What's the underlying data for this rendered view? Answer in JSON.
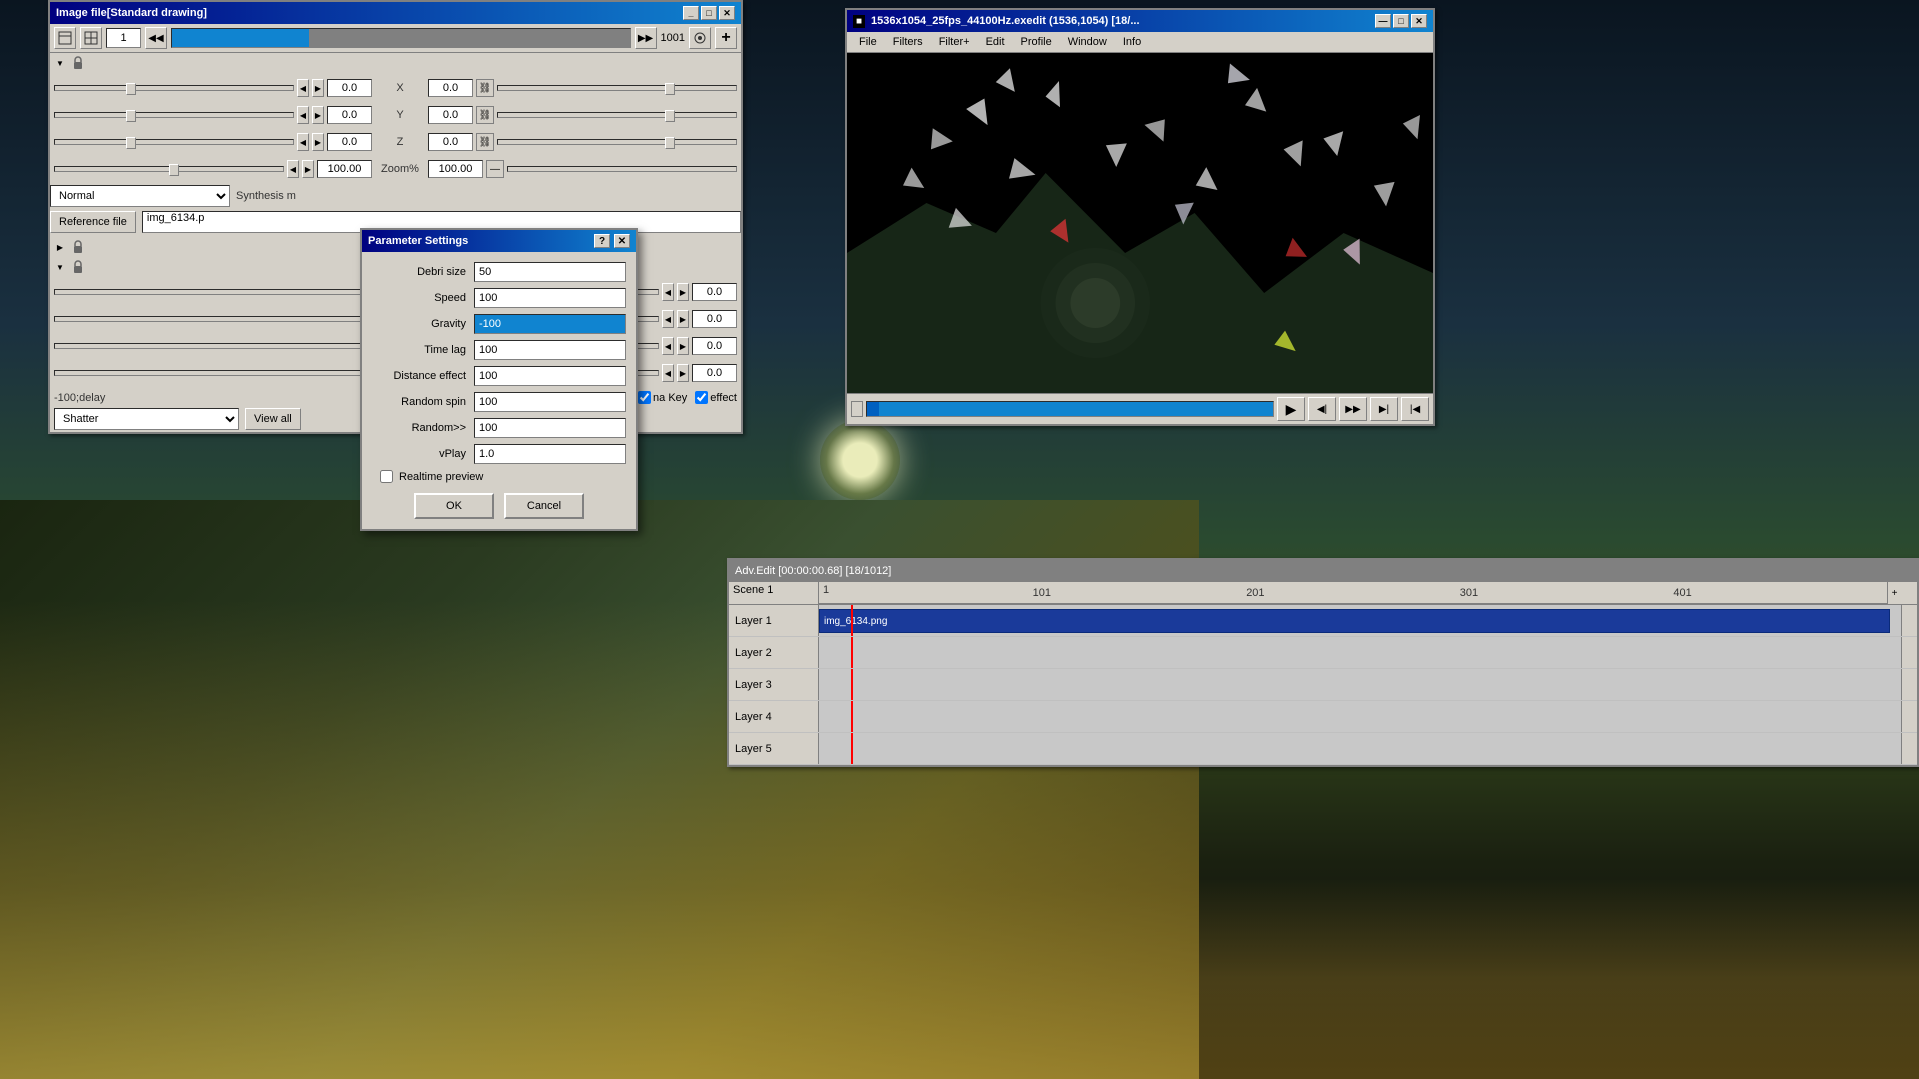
{
  "background": {
    "description": "dark night scene with water and cliffs"
  },
  "imageFilePanel": {
    "title": "Image file[Standard drawing]",
    "frameStart": "1",
    "frameEnd": "1001",
    "labelRight": "Image file[Standard drawing]",
    "checkboxChecked": true,
    "params": [
      {
        "label": "X",
        "value": "0.0",
        "valueRight": "0.0"
      },
      {
        "label": "Y",
        "value": "0.0",
        "valueRight": "0.0"
      },
      {
        "label": "Z",
        "value": "0.0",
        "valueRight": "0.0"
      },
      {
        "label": "Zoom%",
        "value": "100.00",
        "valueRight": "100.00"
      }
    ],
    "params2": [
      {
        "value": "0.0"
      },
      {
        "value": "0.0"
      },
      {
        "value": "0.0"
      },
      {
        "value": "0.0"
      }
    ],
    "normalLabel": "Normal",
    "synthesisLabel": "Synthesis m",
    "referenceFileLabel": "Reference file",
    "referenceFileValue": "img_6134.p",
    "chromaKeyLabel": "na Key",
    "chromaKeyChecked": true,
    "distanceEffectLabel": "effect",
    "distanceEffectChecked": true,
    "shatterLabel": "Shatter",
    "viewAllLabel": "View all",
    "effectText": "-100;delay"
  },
  "paramDialog": {
    "title": "Parameter Settings",
    "fields": [
      {
        "label": "Debri size",
        "value": "50",
        "selected": false
      },
      {
        "label": "Speed",
        "value": "100",
        "selected": false
      },
      {
        "label": "Gravity",
        "value": "-100",
        "selected": true
      },
      {
        "label": "Time lag",
        "value": "100",
        "selected": false
      },
      {
        "label": "Distance effect",
        "value": "100",
        "selected": false
      },
      {
        "label": "Random spin",
        "value": "100",
        "selected": false
      },
      {
        "label": "Random>>",
        "value": "100",
        "selected": false
      },
      {
        "label": "vPlay",
        "value": "1.0",
        "selected": false
      }
    ],
    "realtimePreview": "Realtime preview",
    "okLabel": "OK",
    "cancelLabel": "Cancel"
  },
  "videoWindow": {
    "title": "1536x1054_25fps_44100Hz.exedit (1536,1054) [18/...",
    "menuItems": [
      "File",
      "Filters",
      "Filter+",
      "Edit",
      "Profile",
      "Window",
      "Info"
    ],
    "playBtn": "▶",
    "prevBtn": "◀◀",
    "nextBtn": "▶▶",
    "endBtn": "▶|",
    "beginBtn": "|◀"
  },
  "advEdit": {
    "title": "Adv.Edit [00:00:00.68] [18/1012]",
    "sceneLabel": "Scene 1",
    "rulerMarks": [
      "1",
      "101",
      "201",
      "301",
      "401"
    ],
    "layers": [
      {
        "label": "Layer 1",
        "hasClip": true,
        "clipLabel": "img_6134.png",
        "clipLeft": "0%",
        "clipWidth": "100%"
      },
      {
        "label": "Layer 2",
        "hasClip": false
      },
      {
        "label": "Layer 3",
        "hasClip": false
      },
      {
        "label": "Layer 4",
        "hasClip": false
      },
      {
        "label": "Layer 5",
        "hasClip": false
      }
    ]
  }
}
